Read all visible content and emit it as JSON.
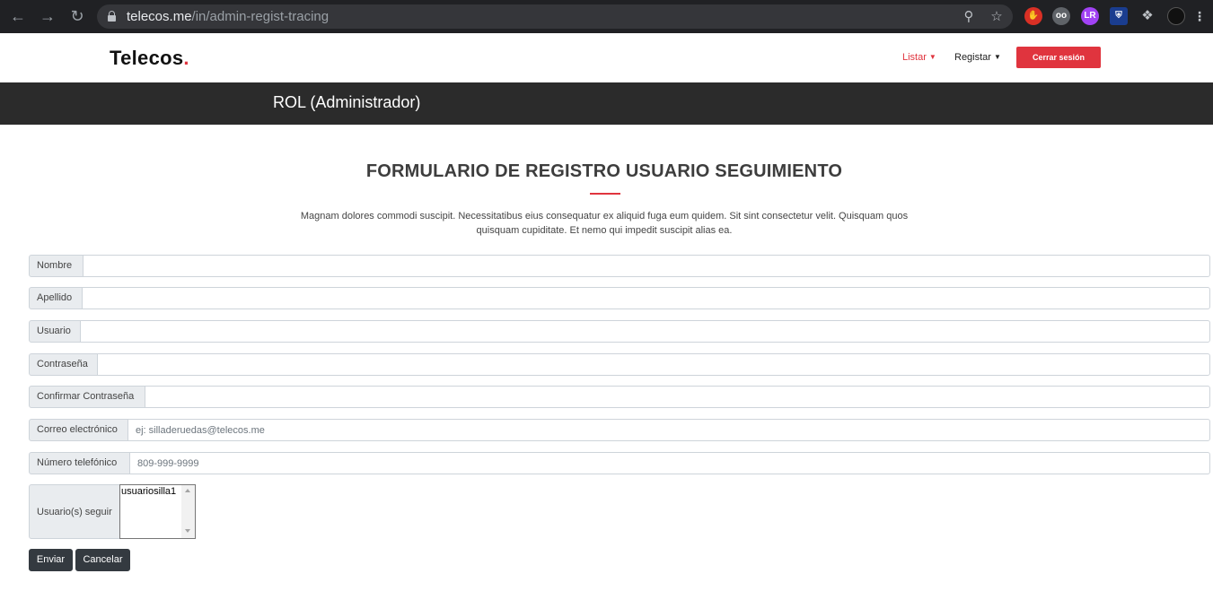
{
  "browser": {
    "url_host": "telecos.me",
    "url_path": "/in/admin-regist-tracing"
  },
  "header": {
    "logo": "Telecos",
    "logo_dot": ".",
    "menu": [
      {
        "label": "Listar",
        "active": true
      },
      {
        "label": "Registar",
        "active": false
      }
    ],
    "logout_label": "Cerrar sesión"
  },
  "role_bar": {
    "title": "ROL (Administrador)"
  },
  "form": {
    "title": "FORMULARIO DE REGISTRO USUARIO SEGUIMIENTO",
    "description_line1": "Magnam dolores commodi suscipit. Necessitatibus eius consequatur ex aliquid fuga eum quidem. Sit sint consectetur velit. Quisquam quos",
    "description_line2": "quisquam cupiditate. Et nemo qui impedit suscipit alias ea.",
    "fields": {
      "nombre": {
        "label": "Nombre",
        "value": "",
        "placeholder": ""
      },
      "apellido": {
        "label": "Apellido",
        "value": "",
        "placeholder": ""
      },
      "usuario": {
        "label": "Usuario",
        "value": "",
        "placeholder": ""
      },
      "contrasena": {
        "label": "Contraseña",
        "value": "",
        "placeholder": ""
      },
      "confirmar": {
        "label": "Confirmar Contraseña",
        "value": "",
        "placeholder": ""
      },
      "correo": {
        "label": "Correo electrónico",
        "value": "",
        "placeholder": "ej: silladeruedas@telecos.me"
      },
      "telefono": {
        "label": "Número telefónico",
        "value": "",
        "placeholder": "809-999-9999"
      }
    },
    "follow": {
      "label": "Usuario(s) seguir",
      "options": [
        "usuariosilla1"
      ]
    },
    "submit_label": "Enviar",
    "cancel_label": "Cancelar"
  },
  "colors": {
    "accent": "#e0343e",
    "dark_bar": "#2b2b2b",
    "button_dark": "#343a40"
  }
}
